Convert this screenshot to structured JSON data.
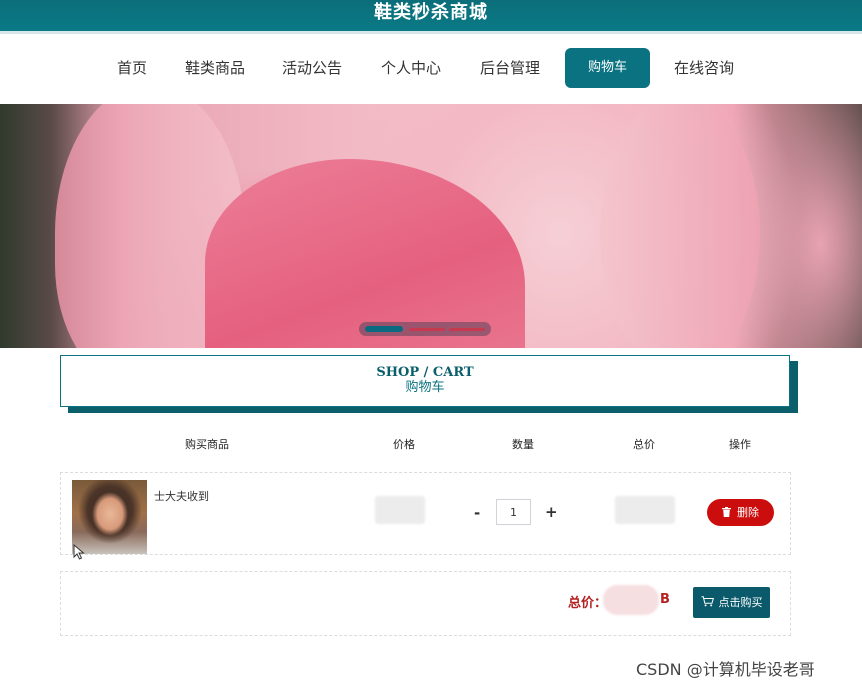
{
  "header": {
    "site_title": "鞋类秒杀商城"
  },
  "nav": {
    "items": [
      {
        "label": "首页"
      },
      {
        "label": "鞋类商品"
      },
      {
        "label": "活动公告"
      },
      {
        "label": "个人中心"
      },
      {
        "label": "后台管理"
      },
      {
        "label": "购物车",
        "active": true
      },
      {
        "label": "在线咨询"
      }
    ]
  },
  "banner": {
    "slide_count": 3,
    "active_slide": 1
  },
  "section": {
    "title_en": "SHOP / CART",
    "title_cn": "购物车"
  },
  "table": {
    "headers": [
      "购买商品",
      "价格",
      "数量",
      "总价",
      "操作"
    ],
    "rows": [
      {
        "name": "士大夫收到",
        "quantity": "1",
        "delete_label": "删除"
      }
    ]
  },
  "summary": {
    "total_label": "总价：",
    "total_suffix": "B",
    "buy_label": "点击购买"
  },
  "qty": {
    "minus": "-",
    "plus": "+"
  },
  "watermark": "CSDN @计算机毕设老哥",
  "colors": {
    "primary": "#0a7280",
    "danger": "#cc0d0d",
    "price_text": "#b52020"
  }
}
